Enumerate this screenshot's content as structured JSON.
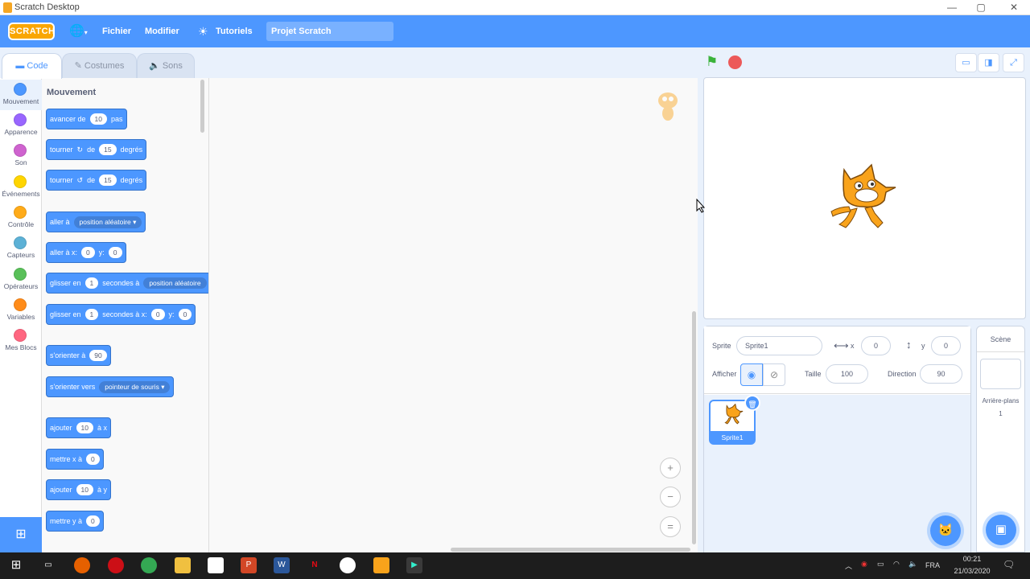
{
  "window": {
    "title": "Scratch Desktop",
    "minimize": "—",
    "maximize": "▢",
    "close": "✕"
  },
  "menubar": {
    "logo": "SCRATCH",
    "globe": "🌐",
    "file": "Fichier",
    "edit": "Modifier",
    "tutorials": "Tutoriels",
    "project_name": "Projet Scratch"
  },
  "tabs": {
    "code": "Code",
    "costumes": "Costumes",
    "sounds": "Sons"
  },
  "categories": [
    {
      "label": "Mouvement",
      "color": "#4c97ff"
    },
    {
      "label": "Apparence",
      "color": "#9966ff"
    },
    {
      "label": "Son",
      "color": "#cf63cf"
    },
    {
      "label": "Événements",
      "color": "#ffd500"
    },
    {
      "label": "Contrôle",
      "color": "#ffab19"
    },
    {
      "label": "Capteurs",
      "color": "#5cb1d6"
    },
    {
      "label": "Opérateurs",
      "color": "#59c059"
    },
    {
      "label": "Variables",
      "color": "#ff8c1a"
    },
    {
      "label": "Mes Blocs",
      "color": "#ff6680"
    }
  ],
  "palette": {
    "title": "Mouvement",
    "blocks": {
      "move": {
        "pre": "avancer de",
        "v1": "10",
        "post": "pas"
      },
      "turn_right": {
        "pre": "tourner",
        "icon": "↻",
        "mid": "de",
        "v1": "15",
        "post": "degrés"
      },
      "turn_left": {
        "pre": "tourner",
        "icon": "↺",
        "mid": "de",
        "v1": "15",
        "post": "degrés"
      },
      "goto": {
        "pre": "aller à",
        "menu": "position aléatoire"
      },
      "goto_xy": {
        "pre": "aller à x:",
        "v1": "0",
        "mid": "y:",
        "v2": "0"
      },
      "glide_to": {
        "pre": "glisser en",
        "v1": "1",
        "mid": "secondes à",
        "menu": "position aléatoire"
      },
      "glide_xy": {
        "pre": "glisser en",
        "v1": "1",
        "mid": "secondes à x:",
        "v2": "0",
        "mid2": "y:",
        "v3": "0"
      },
      "point_dir": {
        "pre": "s'orienter à",
        "v1": "90"
      },
      "point_towards": {
        "pre": "s'orienter vers",
        "menu": "pointeur de souris"
      },
      "change_x": {
        "pre": "ajouter",
        "v1": "10",
        "post": "à x"
      },
      "set_x": {
        "pre": "mettre x à",
        "v1": "0"
      },
      "change_y": {
        "pre": "ajouter",
        "v1": "10",
        "post": "à y"
      },
      "set_y": {
        "pre": "mettre y à",
        "v1": "0"
      }
    }
  },
  "zoom": {
    "in": "+",
    "out": "−",
    "reset": "="
  },
  "sprite_info": {
    "sprite_label": "Sprite",
    "sprite_name": "Sprite1",
    "x_label": "x",
    "x_value": "0",
    "y_label": "y",
    "y_value": "0",
    "show_label": "Afficher",
    "size_label": "Taille",
    "size_value": "100",
    "direction_label": "Direction",
    "direction_value": "90"
  },
  "sprites": [
    {
      "name": "Sprite1"
    }
  ],
  "scene": {
    "title": "Scène",
    "backdrops_label": "Arrière-plans",
    "backdrops_count": "1"
  },
  "taskbar": {
    "lang": "FRA",
    "time": "00:21",
    "date": "21/03/2020"
  },
  "colors": {
    "accent": "#4d97ff",
    "motion": "#4c97ff",
    "cat_orange": "#f9a31b"
  }
}
